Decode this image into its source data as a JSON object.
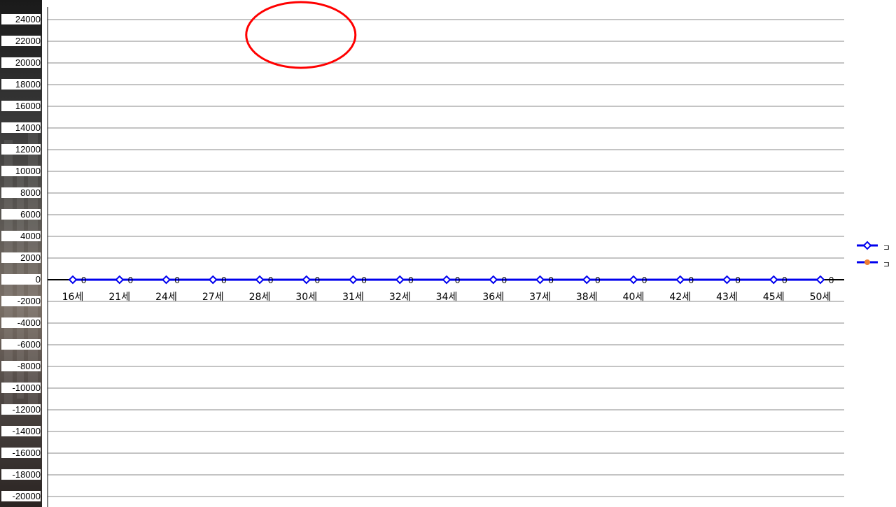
{
  "chart_data": {
    "type": "line",
    "categories": [
      "16세",
      "21세",
      "24세",
      "27세",
      "28세",
      "30세",
      "31세",
      "32세",
      "34세",
      "36세",
      "37세",
      "38세",
      "40세",
      "42세",
      "43세",
      "45세",
      "50세"
    ],
    "series": [
      {
        "name": "ㄷ",
        "marker": "diamond",
        "values": [
          0,
          0,
          0,
          0,
          0,
          0,
          0,
          0,
          0,
          0,
          0,
          0,
          0,
          0,
          0,
          0,
          0
        ],
        "labels": [
          "0",
          "0",
          "0",
          "0",
          "0",
          "0",
          "0",
          "0",
          "0",
          "0",
          "0",
          "0",
          "0",
          "0",
          "0",
          "0",
          "0"
        ]
      },
      {
        "name": "ㄷ",
        "marker": "circle",
        "values": [
          null,
          null,
          null,
          null,
          null,
          null,
          null,
          null,
          null,
          null,
          null,
          null,
          null,
          null,
          null,
          null,
          null
        ],
        "labels": [
          null,
          null,
          null,
          null,
          null,
          null,
          null,
          null,
          null,
          null,
          null,
          null,
          null,
          null,
          null,
          null,
          null
        ]
      }
    ],
    "yticks": [
      "24000",
      "22000",
      "20000",
      "18000",
      "16000",
      "14000",
      "12000",
      "10000",
      "8000",
      "6000",
      "4000",
      "2000",
      "0",
      "-2000",
      "-4000",
      "-6000",
      "-8000",
      "-10000",
      "-12000",
      "-14000",
      "-16000",
      "-18000",
      "-20000"
    ],
    "ylim": [
      -20000,
      24000
    ],
    "grid": true,
    "legend_placement": "right",
    "line_color": "#0000ee",
    "marker_color": "#ee7d31",
    "highlight_color": "#ff0000",
    "highlight_category": "30세"
  }
}
